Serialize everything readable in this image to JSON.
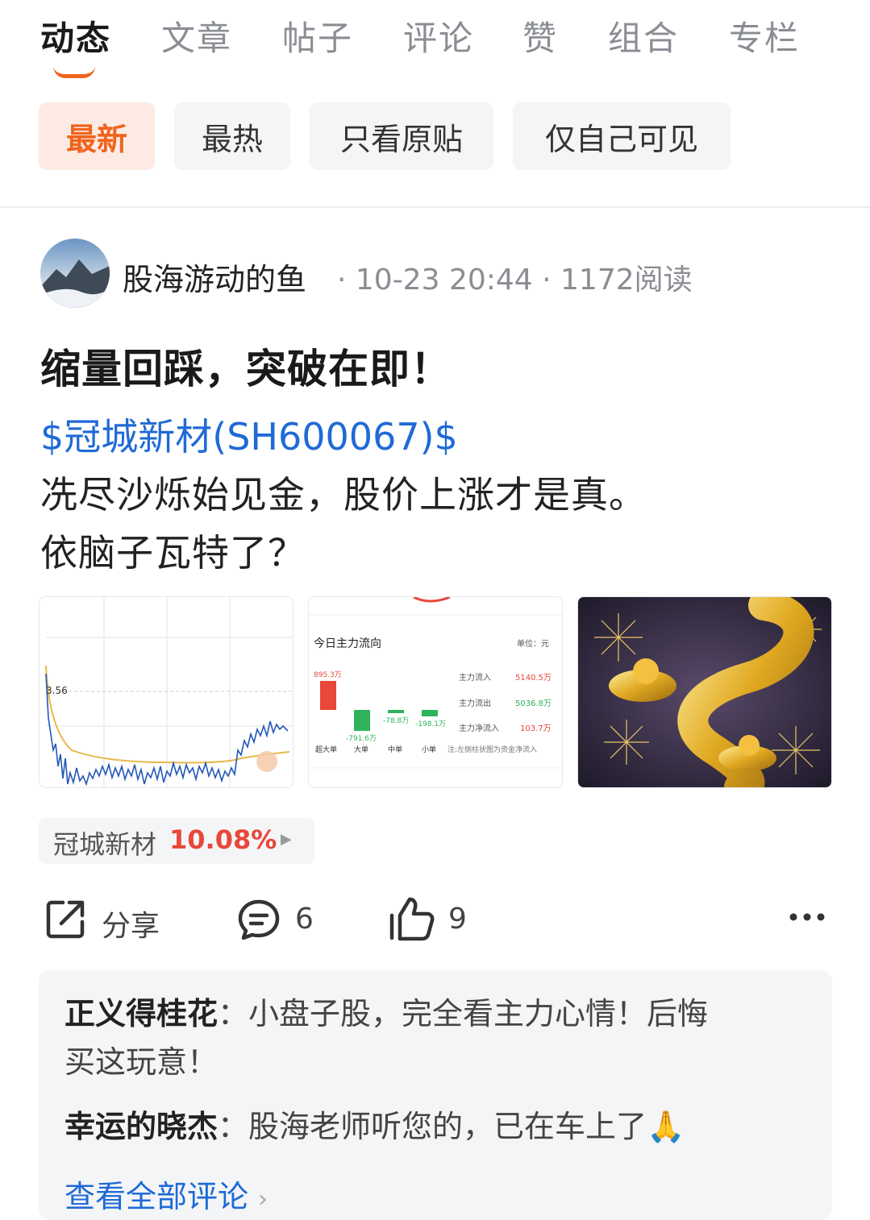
{
  "tabs": [
    "动态",
    "文章",
    "帖子",
    "评论",
    "赞",
    "组合",
    "专栏"
  ],
  "filters": [
    "最新",
    "最热",
    "只看原贴",
    "仅自己可见"
  ],
  "post": {
    "author": "股海游动的鱼",
    "meta": "· 10-23 20:44 · 1172阅读",
    "title": "缩量回踩，突破在即！",
    "stock_link": "$冠城新材(SH600067)$",
    "body_line1": "冼尽沙烁始见金，股价上涨才是真。",
    "body_line2": "依脑子瓦特了？"
  },
  "images": {
    "chart1": {
      "price_label": "3.56"
    },
    "chart2": {
      "title": "今日主力流向",
      "unit": "单位：元",
      "bars": [
        {
          "label": "超大单",
          "value_label": "895.3万"
        },
        {
          "label": "大单",
          "value_label": "-791.6万"
        },
        {
          "label": "中单",
          "value_label": "-78.8万"
        },
        {
          "label": "小单",
          "value_label": "-198.1万"
        }
      ],
      "summary": [
        {
          "label": "主力流入",
          "value": "5140.5万"
        },
        {
          "label": "主力流出",
          "value": "5036.8万"
        },
        {
          "label": "主力净流入",
          "value": "103.7万"
        }
      ],
      "note": "注:左侧柱状图为资金净流入"
    }
  },
  "stock_chip": {
    "name": "冠城新材",
    "change": "10.08%"
  },
  "actions": {
    "share": "分享",
    "comments": "6",
    "likes": "9"
  },
  "comments": [
    {
      "user": "正义得桂花",
      "sep": "：",
      "text_line1": "小盘子股，完全看主力心情！后悔",
      "text_line2": "买这玩意！"
    },
    {
      "user": "幸运的晓杰",
      "sep": "：",
      "text": "股海老师听您的，已在车上了🙏"
    }
  ],
  "view_all": "查看全部评论",
  "colors": {
    "accent": "#f0641e",
    "link": "#1f6ad6",
    "up": "#e8473a",
    "down": "#2fb35a"
  }
}
